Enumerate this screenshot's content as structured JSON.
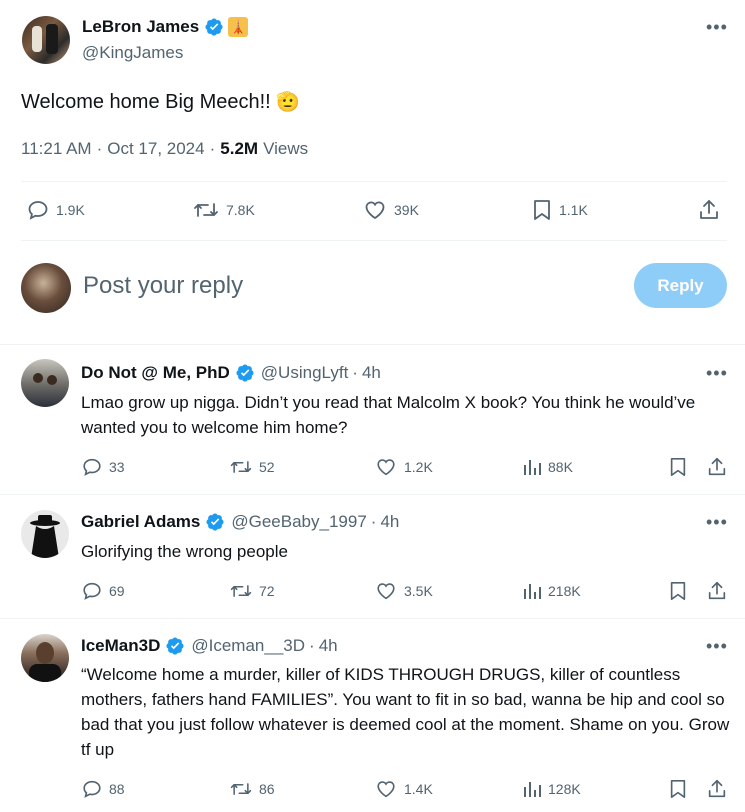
{
  "main_tweet": {
    "author_name": "LeBron James",
    "author_handle": "@KingJames",
    "badge_emoji": "🗼",
    "text": "Welcome home Big Meech!!",
    "text_emoji": "🫡",
    "time": "11:21 AM",
    "date": "Oct 17, 2024",
    "views_count": "5.2M",
    "views_label": "Views",
    "replies": "1.9K",
    "reposts": "7.8K",
    "likes": "39K",
    "bookmarks": "1.1K"
  },
  "composer": {
    "placeholder": "Post your reply",
    "button_label": "Reply"
  },
  "replies": [
    {
      "name": "Do Not @ Me, PhD",
      "handle": "@UsingLyft",
      "age": "4h",
      "text": "Lmao grow up nigga. Didn’t you read that Malcolm X book? You think he would’ve wanted you to welcome him home?",
      "replies": "33",
      "reposts": "52",
      "likes": "1.2K",
      "views": "88K"
    },
    {
      "name": "Gabriel Adams",
      "handle": "@GeeBaby_1997",
      "age": "4h",
      "text": "Glorifying the wrong people",
      "replies": "69",
      "reposts": "72",
      "likes": "3.5K",
      "views": "218K"
    },
    {
      "name": "IceMan3D",
      "handle": "@Iceman__3D",
      "age": "4h",
      "text": "“Welcome home a murder, killer of KIDS THROUGH DRUGS, killer of countless mothers, fathers hand FAMILIES”. You want to fit in so bad, wanna be hip and cool so bad that you just follow whatever is deemed cool at the moment. Shame on you. Grow tf up",
      "replies": "88",
      "reposts": "86",
      "likes": "1.4K",
      "views": "128K"
    }
  ],
  "colors": {
    "verified": "#1d9bf0",
    "reply_button": "#8ecdf7",
    "muted_text": "#536471",
    "divider": "#eff3f4"
  }
}
